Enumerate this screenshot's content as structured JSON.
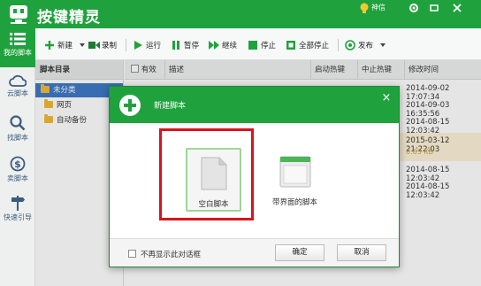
{
  "app": {
    "title": "按键精灵",
    "account_label": "神信"
  },
  "colors": {
    "brand": "#1fa23d",
    "selection": "#3b77c4",
    "highlight_box": "#d7141e"
  },
  "sidebar": {
    "items": [
      {
        "label": "我的脚本",
        "icon": "script-list-icon",
        "active": true
      },
      {
        "label": "云脚本",
        "icon": "cloud-icon",
        "active": false
      },
      {
        "label": "找脚本",
        "icon": "magnifier-icon",
        "active": false
      },
      {
        "label": "卖脚本",
        "icon": "dollar-icon",
        "active": false
      },
      {
        "label": "快速引导",
        "icon": "signpost-icon",
        "active": false
      }
    ]
  },
  "toolbar": {
    "new_label": "新建",
    "record_label": "录制",
    "run_label": "运行",
    "pause_label": "暂停",
    "continue_label": "继续",
    "stop_label": "停止",
    "stop_all_label": "全部停止",
    "publish_label": "发布"
  },
  "tree": {
    "header": "脚本目录",
    "nodes": [
      {
        "label": "未分类",
        "selected": true
      },
      {
        "label": "网页",
        "selected": false
      },
      {
        "label": "自动备份",
        "selected": false
      }
    ]
  },
  "table": {
    "headers": {
      "valid": "有效",
      "desc": "描述",
      "start_hotkey": "启动热键",
      "stop_hotkey": "中止热键",
      "modified": "修改时间"
    },
    "rows": [
      {
        "modified": "2014-09-02 17:07:34",
        "meta": ""
      },
      {
        "modified": "2014-09-03 16:35:56",
        "meta": ""
      },
      {
        "modified": "2014-08-15 12:03:42",
        "meta": ""
      },
      {
        "modified": "2015-03-12 21:22:03",
        "meta": "0.63 KB",
        "highlight": true
      },
      {
        "modified": "2014-08-15 12:03:42",
        "meta": ""
      },
      {
        "modified": "2014-08-15 12:03:42",
        "meta": ""
      }
    ]
  },
  "dialog": {
    "title": "新建脚本",
    "close_glyph": "×",
    "choices": [
      {
        "label": "空白脚本",
        "icon": "blank-page-icon"
      },
      {
        "label": "带界面的脚本",
        "icon": "ui-window-icon"
      }
    ],
    "dont_show_label": "不再显示此对话框",
    "ok_label": "确定",
    "cancel_label": "取消"
  }
}
